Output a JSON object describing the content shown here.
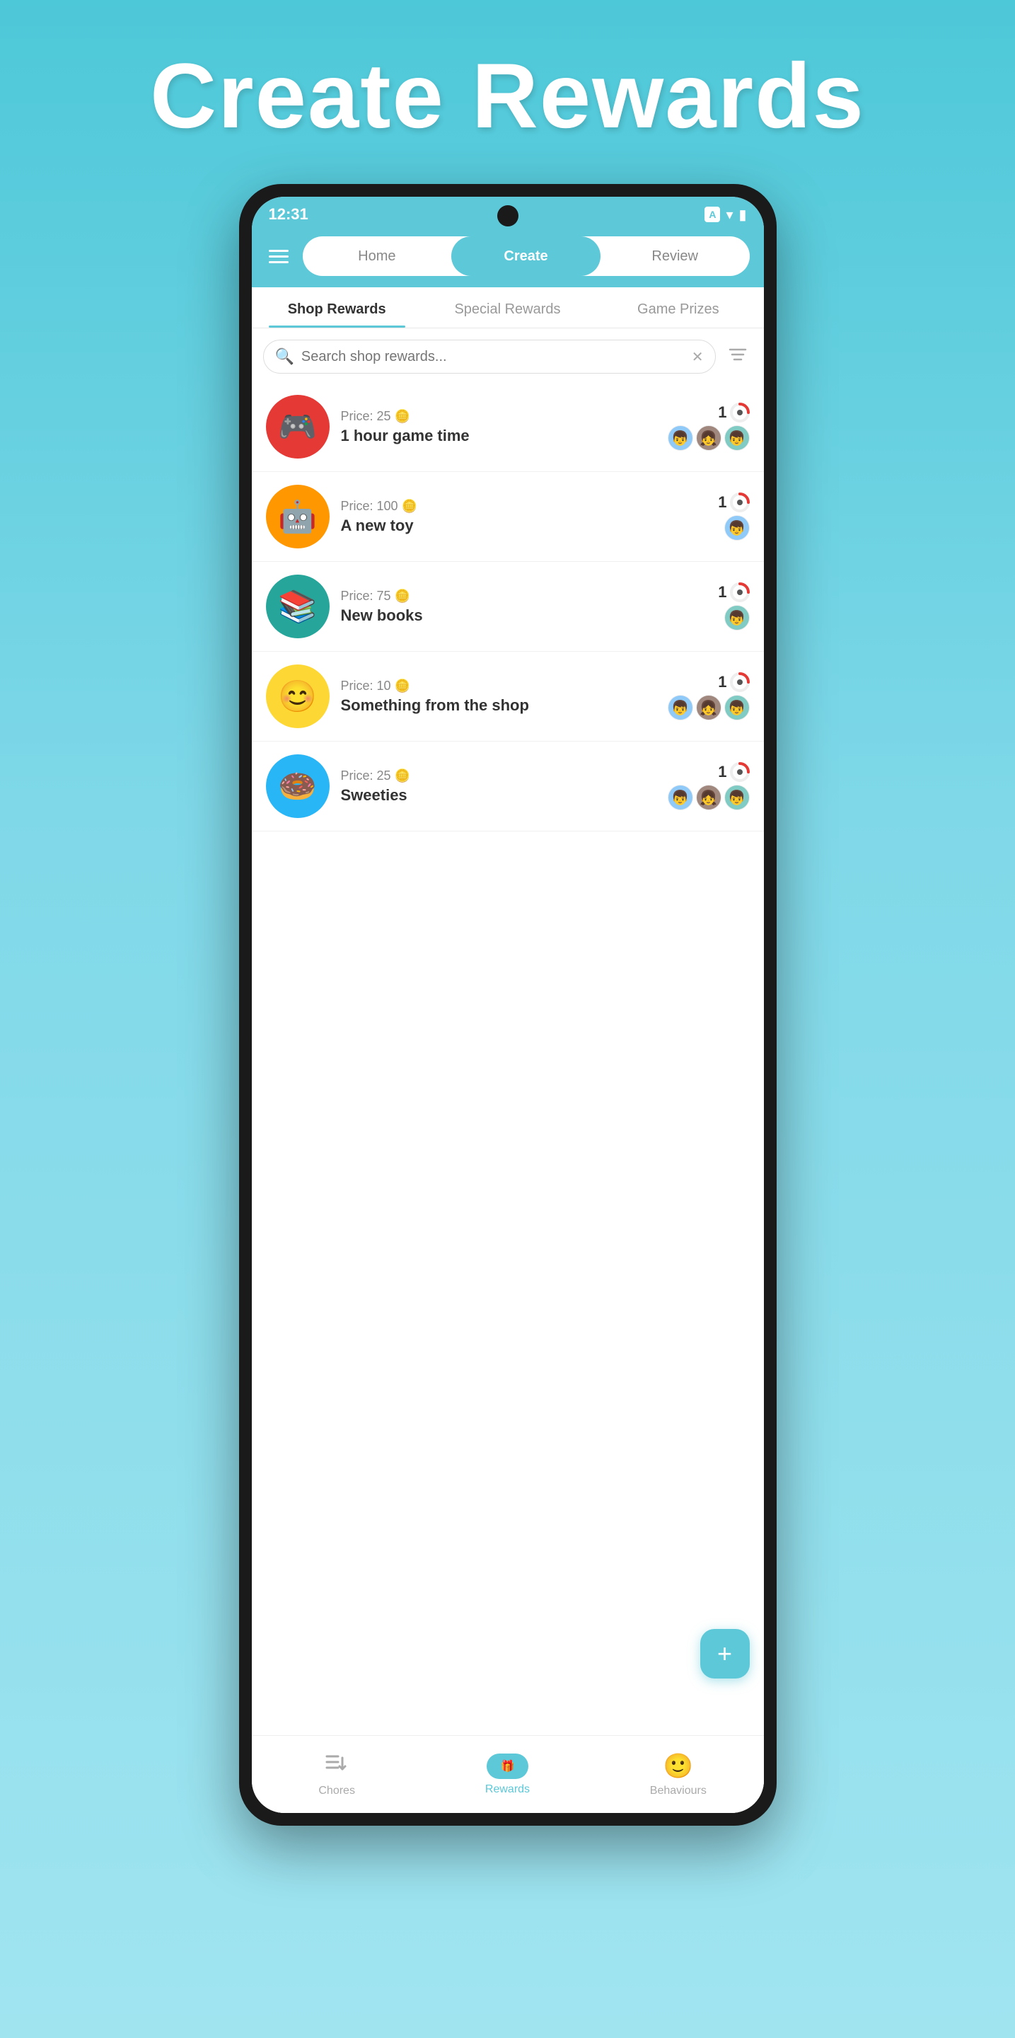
{
  "page": {
    "title": "Create Rewards",
    "background_color": "#4dc8d8"
  },
  "status_bar": {
    "time": "12:31",
    "icon_a": "A"
  },
  "nav": {
    "tabs": [
      {
        "id": "home",
        "label": "Home",
        "active": false
      },
      {
        "id": "create",
        "label": "Create",
        "active": true
      },
      {
        "id": "review",
        "label": "Review",
        "active": false
      }
    ]
  },
  "sub_tabs": [
    {
      "id": "shop_rewards",
      "label": "Shop Rewards",
      "active": true
    },
    {
      "id": "special_rewards",
      "label": "Special Rewards",
      "active": false
    },
    {
      "id": "game_prizes",
      "label": "Game Prizes",
      "active": false
    }
  ],
  "search": {
    "placeholder": "Search shop rewards...",
    "value": ""
  },
  "rewards": [
    {
      "id": "game_time",
      "icon": "🎮",
      "icon_bg": "red",
      "price": 25,
      "name": "1 hour game time",
      "count": 1,
      "avatars": [
        "👦",
        "👧",
        "👦"
      ]
    },
    {
      "id": "new_toy",
      "icon": "🤖",
      "icon_bg": "orange",
      "price": 100,
      "name": "A new toy",
      "count": 1,
      "avatars": [
        "👦"
      ]
    },
    {
      "id": "new_books",
      "icon": "📚",
      "icon_bg": "teal",
      "price": 75,
      "name": "New books",
      "count": 1,
      "avatars": [
        "👦"
      ]
    },
    {
      "id": "shop_item",
      "icon": "😊",
      "icon_bg": "yellow",
      "price": 10,
      "name": "Something from the shop",
      "count": 1,
      "avatars": [
        "👦",
        "👧",
        "👦"
      ]
    },
    {
      "id": "sweeties",
      "icon": "🍩",
      "icon_bg": "light-blue",
      "price": 25,
      "name": "Sweeties",
      "count": 1,
      "avatars": [
        "👦",
        "👧",
        "👦"
      ]
    }
  ],
  "fab": {
    "label": "+"
  },
  "bottom_nav": [
    {
      "id": "chores",
      "label": "Chores",
      "icon": "☰",
      "active": false
    },
    {
      "id": "rewards",
      "label": "Rewards",
      "icon": "🎁",
      "active": true
    },
    {
      "id": "behaviours",
      "label": "Behaviours",
      "icon": "😊",
      "active": false
    }
  ]
}
